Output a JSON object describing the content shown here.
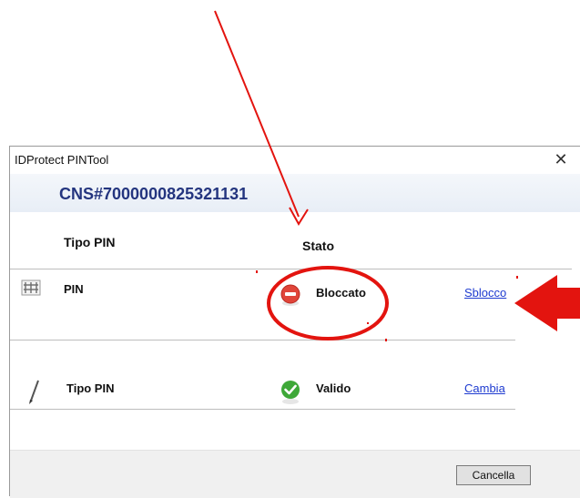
{
  "window": {
    "title": "IDProtect PINTool",
    "close_glyph": "✕"
  },
  "card_id": "CNS#7000000825321131",
  "columns": {
    "tipo_pin": "Tipo PIN",
    "stato": "Stato"
  },
  "rows": [
    {
      "icon": "keypad-icon",
      "label": "PIN",
      "status_icon": "blocked-icon",
      "status": "Bloccato",
      "action": "Sblocco"
    },
    {
      "icon": "pen-icon",
      "label": "Tipo PIN",
      "status_icon": "valid-check-icon",
      "status": "Valido",
      "action": "Cambia"
    }
  ],
  "footer": {
    "cancel_label": "Cancella"
  },
  "annotations": {
    "color": "#e3140f"
  }
}
